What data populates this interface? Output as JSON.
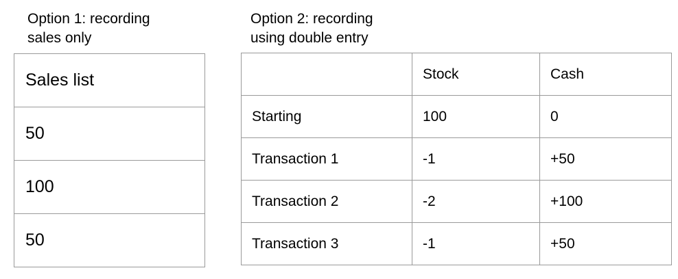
{
  "option1": {
    "caption_line1": "Option 1: recording",
    "caption_line2": "sales only",
    "header": "Sales list",
    "values": [
      "50",
      "100",
      "50"
    ]
  },
  "option2": {
    "caption_line1": "Option 2: recording",
    "caption_line2": "using double entry",
    "columns": [
      "",
      "Stock",
      "Cash"
    ],
    "rows": [
      [
        "Starting",
        "100",
        "0"
      ],
      [
        "Transaction 1",
        "-1",
        "+50"
      ],
      [
        "Transaction 2",
        "-2",
        "+100"
      ],
      [
        "Transaction 3",
        "-1",
        "+50"
      ]
    ]
  }
}
